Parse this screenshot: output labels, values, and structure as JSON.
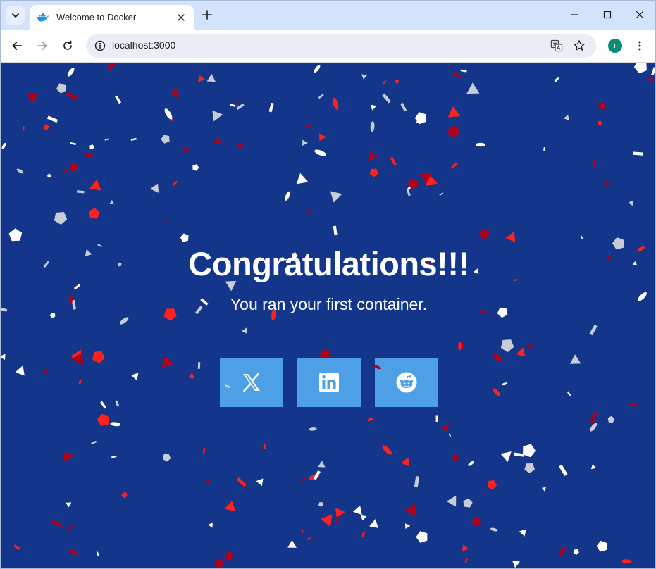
{
  "browser": {
    "tab_title": "Welcome to Docker",
    "url": "localhost:3000",
    "profile_initial": "r"
  },
  "page": {
    "headline": "Congratulations!!!",
    "subline": "You ran your first container.",
    "background_color": "#14368a",
    "button_color": "#4d9fe6",
    "share_buttons": [
      {
        "icon": "x-icon"
      },
      {
        "icon": "linkedin-icon"
      },
      {
        "icon": "reddit-icon"
      }
    ],
    "confetti_colors": [
      "#ffffff",
      "#c8ccd6",
      "#ff2020",
      "#b3001a"
    ]
  }
}
